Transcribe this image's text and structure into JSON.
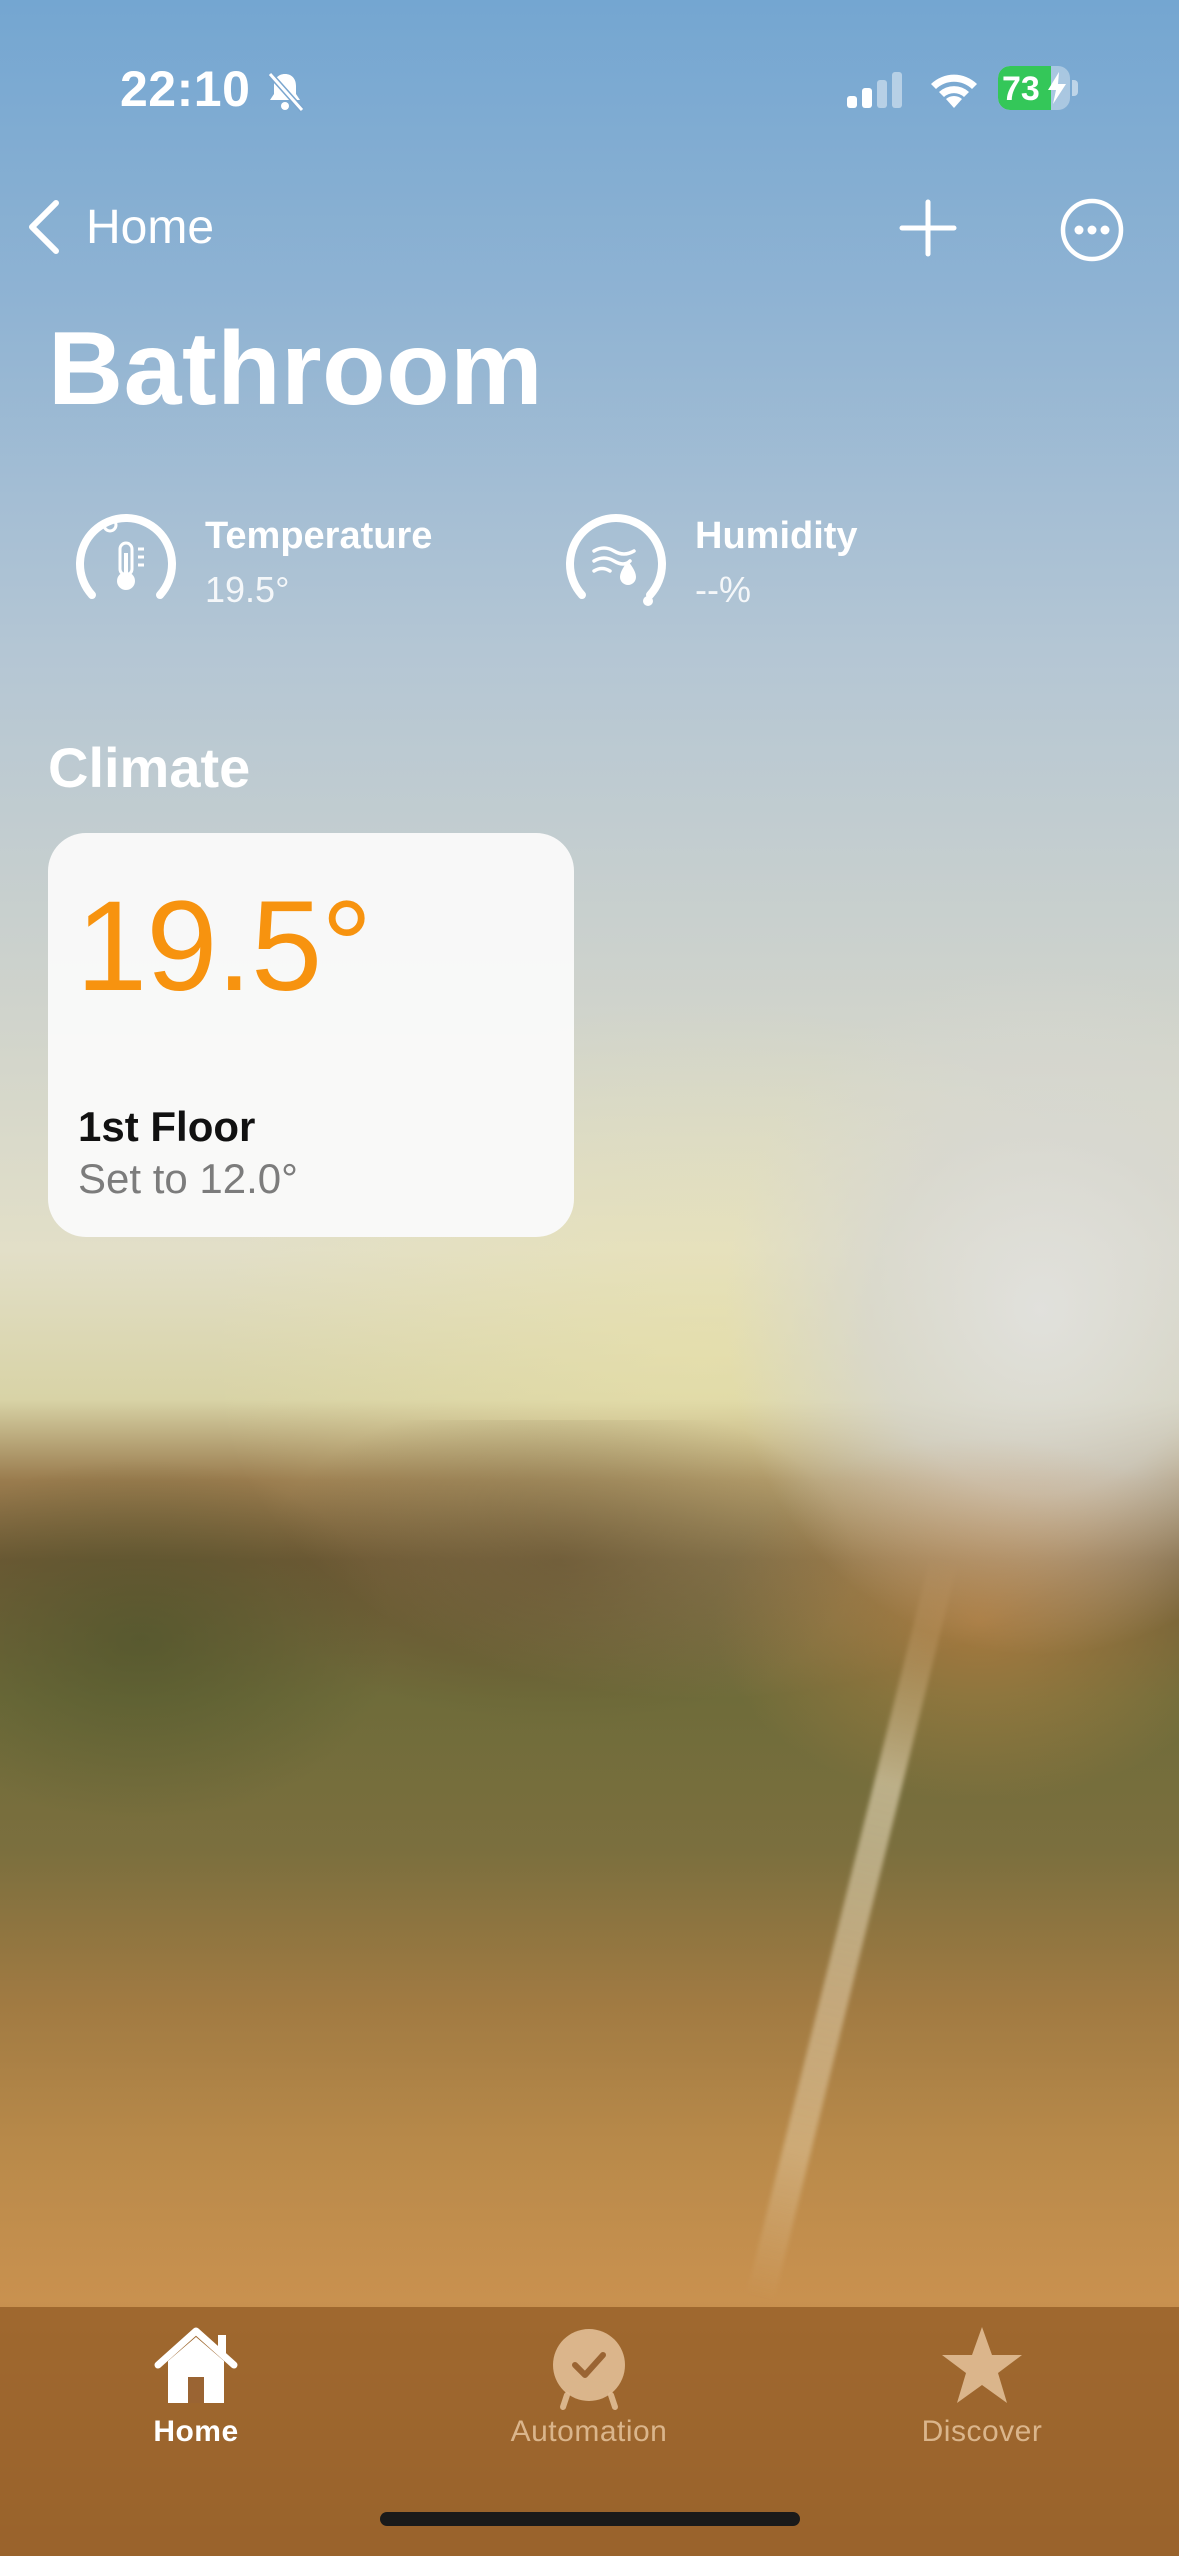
{
  "status_bar": {
    "time": "22:10",
    "battery_level": "73",
    "battery_fraction": 0.73,
    "signal_bars_active": 2,
    "icons": [
      "bell-slash-icon",
      "cellular-signal-icon",
      "wifi-icon",
      "battery-charging-icon"
    ]
  },
  "nav": {
    "back_label": "Home",
    "add_icon": "plus-icon",
    "more_icon": "ellipsis-circle-icon"
  },
  "page": {
    "title": "Bathroom"
  },
  "sensors": [
    {
      "label": "Temperature",
      "value": "19.5°",
      "icon": "thermometer-gauge-icon"
    },
    {
      "label": "Humidity",
      "value": "--%",
      "icon": "humidity-gauge-icon"
    }
  ],
  "climate": {
    "section_title": "Climate",
    "tile": {
      "temperature": "19.5°",
      "name": "1st Floor",
      "status": "Set to 12.0°",
      "accent_color": "#f7930f"
    }
  },
  "tabbar": {
    "tabs": [
      {
        "label": "Home",
        "icon": "house-icon",
        "active": true
      },
      {
        "label": "Automation",
        "icon": "clock-check-icon",
        "active": false
      },
      {
        "label": "Discover",
        "icon": "star-icon",
        "active": false
      }
    ]
  },
  "colors": {
    "accent_orange": "#f7930f",
    "battery_green": "#34c759"
  }
}
